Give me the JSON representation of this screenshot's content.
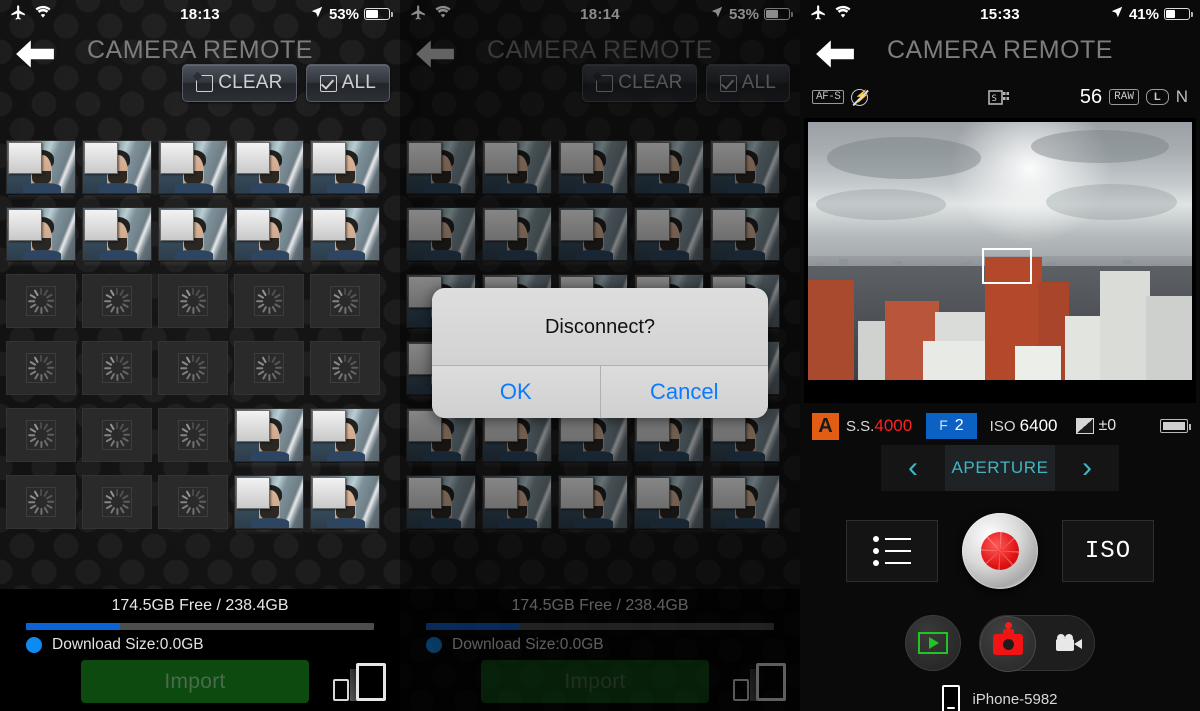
{
  "panels": [
    {
      "id": "photo-browser",
      "status_bar": {
        "airplane_icon": "airplane-icon",
        "wifi_icon": "wifi-icon",
        "time": "18:13",
        "location_icon": "location-arrow-icon",
        "battery_percent": "53%",
        "battery_level": 53
      },
      "title": "CAMERA REMOTE",
      "back_icon": "back-arrow-icon",
      "buttons": {
        "clear": "CLEAR",
        "all": "ALL"
      },
      "grid": {
        "columns": 5,
        "rows": [
          [
            "photo",
            "photo",
            "photo",
            "photo",
            "photo"
          ],
          [
            "photo",
            "photo",
            "photo",
            "photo",
            "photo"
          ],
          [
            "loading",
            "loading",
            "loading",
            "loading",
            "loading"
          ],
          [
            "loading",
            "loading",
            "loading",
            "loading",
            "loading"
          ],
          [
            "loading",
            "loading",
            "loading",
            "photo",
            "photo"
          ],
          [
            "loading",
            "loading",
            "loading",
            "photo",
            "photo"
          ]
        ]
      },
      "footer": {
        "storage": "174.5GB Free / 238.4GB",
        "progress_percent": 27,
        "download_size": "Download Size:0.0GB",
        "import_label": "Import",
        "transfer_icon": "camera-to-phone-transfer-icon"
      },
      "modal": null
    },
    {
      "id": "photo-browser-disconnect",
      "status_bar": {
        "airplane_icon": "airplane-icon",
        "wifi_icon": "wifi-icon",
        "time": "18:14",
        "location_icon": "location-arrow-icon",
        "battery_percent": "53%",
        "battery_level": 53
      },
      "title": "CAMERA REMOTE",
      "back_icon": "back-arrow-icon",
      "buttons": {
        "clear": "CLEAR",
        "all": "ALL"
      },
      "grid": {
        "columns": 5,
        "rows": [
          [
            "photo",
            "photo",
            "photo",
            "photo",
            "photo"
          ],
          [
            "photo",
            "photo",
            "photo",
            "photo",
            "photo"
          ],
          [
            "photo",
            "photo",
            "photo",
            "photo",
            "photo"
          ],
          [
            "photo",
            "photo",
            "photo",
            "photo",
            "photo"
          ],
          [
            "photo",
            "photo",
            "photo",
            "photo",
            "photo"
          ],
          [
            "photo",
            "photo",
            "photo",
            "photo",
            "photo"
          ]
        ]
      },
      "footer": {
        "storage": "174.5GB Free / 238.4GB",
        "progress_percent": 27,
        "download_size": "Download Size:0.0GB",
        "import_label": "Import",
        "transfer_icon": "camera-to-phone-transfer-icon"
      },
      "modal": {
        "message": "Disconnect?",
        "ok_label": "OK",
        "cancel_label": "Cancel",
        "button_color": "#0a7bff"
      }
    }
  ],
  "camera_panel": {
    "id": "camera-live-view",
    "status_bar": {
      "airplane_icon": "airplane-icon",
      "wifi_icon": "wifi-icon",
      "time": "15:33",
      "location_icon": "location-arrow-icon",
      "battery_percent": "41%",
      "battery_level": 41
    },
    "title": "CAMERA REMOTE",
    "back_icon": "back-arrow-icon",
    "info_bar": {
      "focus_mode": "AF-S",
      "flash_icon": "flash-off-icon",
      "drive_mode_icon": "drive-mode-icon",
      "shots_remaining": "56",
      "quality": "RAW",
      "image_size": "L",
      "compression": "N"
    },
    "live_view": {
      "af_box": "af-focus-box",
      "scene": "cityscape-overcast-sky"
    },
    "exposure": {
      "mode": "A",
      "mode_color": "#e25c13",
      "shutter_label": "S.S.",
      "shutter_value": "4000",
      "shutter_color": "#ff2020",
      "aperture_label": "F",
      "aperture_value": "2",
      "aperture_bg": "#0b62c4",
      "iso_label": "ISO",
      "iso_value": "6400",
      "exposure_comp": "±0",
      "battery_icon": "camera-battery-icon"
    },
    "aperture_control": {
      "prev_icon": "chevron-left-icon",
      "label": "APERTURE",
      "next_icon": "chevron-right-icon",
      "accent_color": "#3fb6c4"
    },
    "controls": {
      "menu_icon": "list-menu-icon",
      "shutter_icon": "shutter-release-button",
      "iso_label": "ISO"
    },
    "bottom": {
      "playback_icon": "playback-play-icon",
      "still_icon": "still-camera-icon",
      "video_icon": "video-camera-icon",
      "device_icon": "phone-device-icon",
      "device_name": "iPhone-5982"
    }
  }
}
